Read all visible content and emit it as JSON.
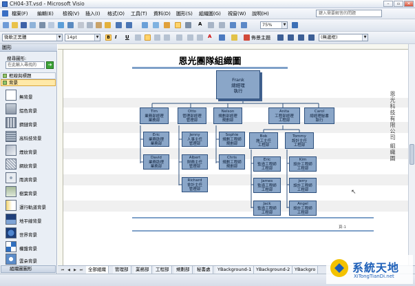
{
  "window": {
    "title": "CH04-3T.vsd - Microsoft Visio"
  },
  "menubar": {
    "items": [
      "檔案(F)",
      "編輯(E)",
      "檢視(V)",
      "插入(I)",
      "格式(O)",
      "工具(T)",
      "資料(D)",
      "圖形(S)",
      "組織圖(G)",
      "視窗(W)",
      "說明(H)"
    ],
    "help_placeholder": "鍵入需要解答的問題"
  },
  "toolbar": {
    "zoom": "75%",
    "font": "微軟正黑體",
    "font_size": "14pt",
    "theme_label": "佈景主題",
    "shape_box": "(無邊框)"
  },
  "shapes_panel": {
    "title": "圖形",
    "search_label": "搜尋圖形:",
    "search_placeholder": "在此輸入尋找的",
    "stencils": [
      "框線與標題",
      "背景"
    ],
    "items": [
      "無背景",
      "鋁色背景",
      "鋼鏈背景",
      "高科技背景",
      "煙紋背景",
      "網紋背景",
      "雨滴背景",
      "樹葉背景",
      "運行軌道背景",
      "地平線背景",
      "世界背景",
      "權盤背景",
      "雲朵背景"
    ],
    "footer": "組織圖圖形"
  },
  "chart": {
    "title": "恩光團隊組織圖",
    "side_text": "恩光科技有限公司 組織圖",
    "ceo": {
      "name": "Frank",
      "title": "總經理",
      "dept": "執行"
    },
    "level2": [
      {
        "name": "Tim",
        "title": "業務部經理",
        "dept": "業務部"
      },
      {
        "name": "Otto",
        "title": "管理部經理",
        "dept": "管理部"
      },
      {
        "name": "Nelson",
        "title": "規劃部經理",
        "dept": "規劃部"
      },
      {
        "name": "Anita",
        "title": "工程部經理",
        "dept": "工程部"
      },
      {
        "name": "Carol",
        "title": "總經理秘書",
        "dept": "執行"
      }
    ],
    "tim_team": [
      {
        "name": "Eric",
        "title": "業務助理",
        "dept": "業務部"
      },
      {
        "name": "David",
        "title": "業務助理",
        "dept": "業務部"
      }
    ],
    "otto_team": [
      {
        "name": "Jenny",
        "title": "人事主任",
        "dept": "管理部"
      },
      {
        "name": "Albert",
        "title": "財務主任",
        "dept": "管理部"
      },
      {
        "name": "Richard",
        "title": "會計主任",
        "dept": "管理部"
      }
    ],
    "nelson_team": [
      {
        "name": "Sophie",
        "title": "規劃工程師",
        "dept": "規劃部"
      },
      {
        "name": "Chris",
        "title": "規劃工程師",
        "dept": "規劃部"
      }
    ],
    "anita_leads": [
      {
        "name": "Bob",
        "title": "施工主任",
        "dept": "工程部"
      },
      {
        "name": "Tommy",
        "title": "設計主任",
        "dept": "工程部"
      }
    ],
    "bob_team": [
      {
        "name": "Eric",
        "title": "監造工程師",
        "dept": "工程部"
      },
      {
        "name": "James",
        "title": "監造工程師",
        "dept": "工程部"
      },
      {
        "name": "Jack",
        "title": "監造工程師",
        "dept": "工程部"
      }
    ],
    "tommy_team": [
      {
        "name": "Kim",
        "title": "設計工程師",
        "dept": "工程部"
      },
      {
        "name": "Jerry",
        "title": "設計工程師",
        "dept": "工程部"
      },
      {
        "name": "Angel",
        "title": "設計工程師",
        "dept": "工程部"
      }
    ],
    "page_marker": "頁-1"
  },
  "page_tabs": [
    "全部組織",
    "管理部",
    "業務部",
    "工程部",
    "規劃部",
    "秘書處",
    "YBackground-1",
    "YBackground-2",
    "YBackgro"
  ],
  "watermark": {
    "text": "系統天地",
    "url": "XiTongTianDi.net"
  }
}
